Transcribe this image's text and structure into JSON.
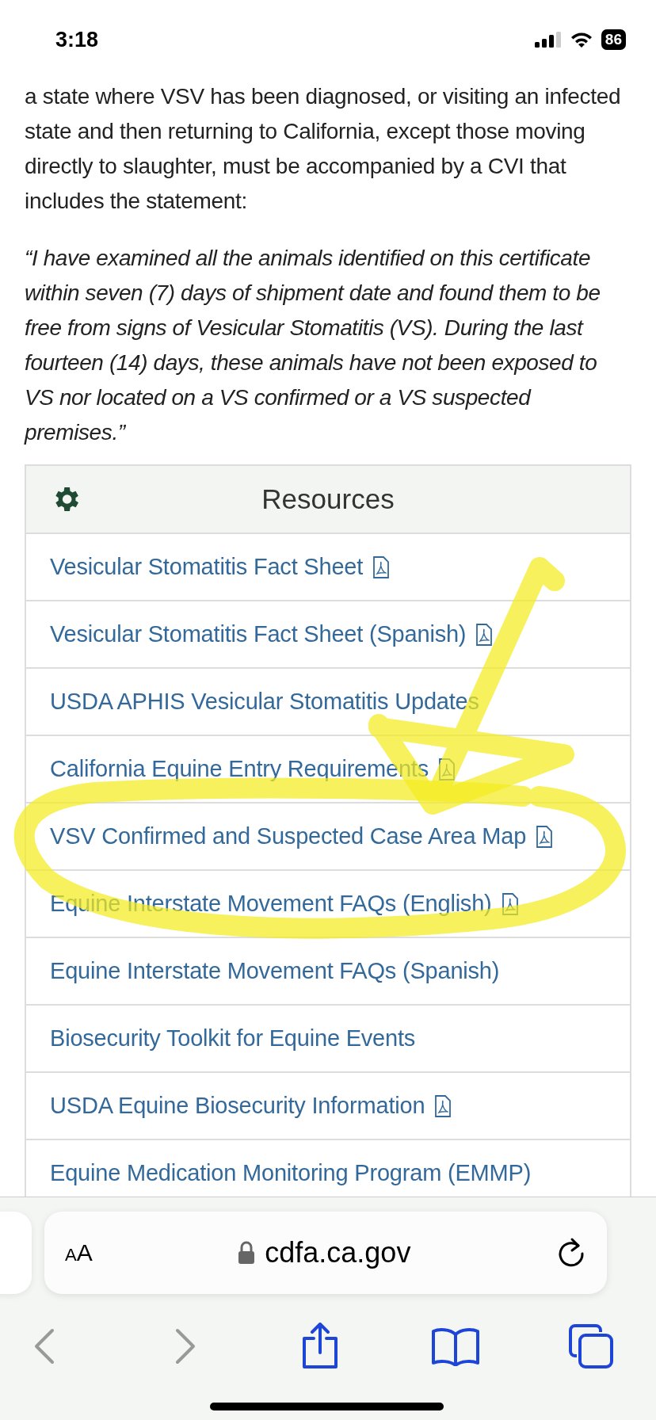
{
  "status_bar": {
    "time": "3:18",
    "battery": "86"
  },
  "intro": "a state where VSV has been diagnosed, or visiting an infected state and then returning to California, except those moving directly to slaughter, must be accompanied by a CVI that includes the statement:",
  "quote": "“I have examined all the animals identified on this certificate within seven (7) days of shipment date and found them to be free from signs of Vesicular Stomatitis (VS). During the last fourteen (14) days, these animals have not been exposed to VS nor located on a VS confirmed or a VS suspected premises.”",
  "resources": {
    "title": "Resources",
    "links": [
      {
        "label": "Vesicular Stomatitis Fact Sheet",
        "pdf": true
      },
      {
        "label": "Vesicular Stomatitis Fact Sheet (Spanish)",
        "pdf": true
      },
      {
        "label": "USDA APHIS Vesicular Stomatitis Updates",
        "pdf": false
      },
      {
        "label": "California Equine Entry Requirements",
        "pdf": true
      },
      {
        "label": "VSV Confirmed and Suspected Case Area Map",
        "pdf": true
      },
      {
        "label": "Equine Interstate Movement FAQs (English)",
        "pdf": true
      },
      {
        "label": "Equine Interstate Movement FAQs (Spanish)",
        "pdf": false
      },
      {
        "label": "Biosecurity Toolkit for Equine Events",
        "pdf": false
      },
      {
        "label": "USDA Equine Biosecurity Information",
        "pdf": true
      },
      {
        "label": "Equine Medication Monitoring Program (EMMP)",
        "pdf": false
      }
    ]
  },
  "browser": {
    "text_size": "AA",
    "address": "cdfa.ca.gov"
  }
}
